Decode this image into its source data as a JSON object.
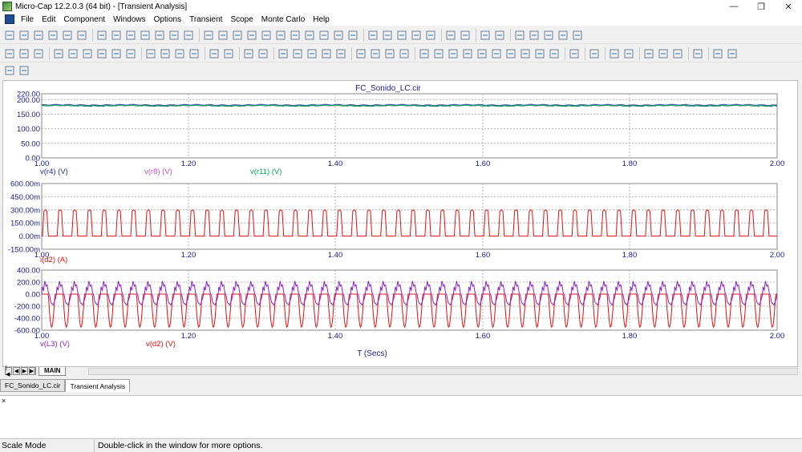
{
  "window": {
    "title": "Micro-Cap 12.2.0.3 (64 bit) - [Transient Analysis]",
    "minimize": "—",
    "restore": "❐",
    "close": "✕"
  },
  "menu": [
    "File",
    "Edit",
    "Component",
    "Windows",
    "Options",
    "Transient",
    "Scope",
    "Monte Carlo",
    "Help"
  ],
  "mdi": {
    "minimize": "—",
    "restore": "❐",
    "close": "✕"
  },
  "toolbar1_icons": [
    "new-icon",
    "open-icon",
    "save-icon",
    "save-all-icon",
    "print-preview-icon",
    "print-icon",
    "sep",
    "undo-icon",
    "redo-icon",
    "cut-icon",
    "copy-icon",
    "paste-icon",
    "delete-icon",
    "select-all-icon",
    "sep",
    "ground-icon",
    "sine-source-icon",
    "capacitor-icon",
    "inductor-icon",
    "diode-icon",
    "transistor-icon",
    "mosfet-icon",
    "opamp-icon",
    "resistor-icon",
    "battery-icon",
    "node-icon",
    "sep",
    "window-icon",
    "window-2-icon",
    "window-3-icon",
    "window-4-icon",
    "window-5-icon",
    "sep",
    "page-icon",
    "calculator-icon",
    "sep",
    "component-icon",
    "list-icon",
    "sep",
    "analysis-icon",
    "options-icon",
    "tools-icon",
    "plot-icon",
    "graph-icon"
  ],
  "toolbar2_icons": [
    "select-arrow-icon",
    "pan-icon",
    "help-icon",
    "sep",
    "zoom-box-icon",
    "scale-icon",
    "data-points-icon",
    "token-icon",
    "formula-icon",
    "text-icon",
    "sep",
    "properties-icon",
    "run-icon",
    "stop-icon",
    "pause-icon",
    "sep",
    "tool-1-icon",
    "tool-2-icon",
    "sep",
    "frame-icon",
    "grid-icon",
    "sep",
    "page-a-icon",
    "page-b-icon",
    "page-c-icon",
    "page-d-icon",
    "page-e-icon",
    "sep",
    "zoom-in-icon",
    "zoom-out-icon",
    "zoom-fit-icon",
    "cursor-icon",
    "sep",
    "peak-icon",
    "valley-icon",
    "high-icon",
    "low-icon",
    "inflection-icon",
    "global-high-icon",
    "global-low-icon",
    "top-icon",
    "bottom-icon",
    "slope-icon",
    "sep",
    "color-icon",
    "sep",
    "table-icon",
    "sep",
    "save-wave-icon",
    "load-wave-icon",
    "sep",
    "magnify-in-icon",
    "magnify-out-icon",
    "restore-view-icon",
    "sep",
    "tile-icon",
    "sep",
    "font-icon",
    "color-a-icon"
  ],
  "toolbar3_icons": [
    "step-icon",
    "tile-2-icon"
  ],
  "tabs": {
    "sheet_nav": [
      "|◀",
      "◀",
      "▶",
      "▶|"
    ],
    "sheet": "MAIN",
    "doc_tabs": [
      "FC_Sonido_LC.cir",
      "Transient Analysis"
    ]
  },
  "output": {
    "close_glyph": "×"
  },
  "status": {
    "mode": "Scale Mode",
    "message": "Double-click in the window for more options."
  },
  "colors": {
    "navy": "#1f2f8c",
    "steel": "#4a6fa8",
    "green": "#00a050",
    "red": "#e01010",
    "purple": "#8b1fc0",
    "magenta": "#c050c0",
    "axis_text": "#1a1a8a",
    "grid": "#a0a0a0"
  },
  "chart_data": [
    {
      "type": "line",
      "title": "FC_Sonido_LC.cir",
      "xlim": [
        1.0,
        2.0
      ],
      "x_ticks": [
        "1.00",
        "1.20",
        "1.40",
        "1.60",
        "1.80",
        "2.00"
      ],
      "ylim": [
        0,
        220
      ],
      "y_ticks": [
        "220.00",
        "200.00",
        "150.00",
        "100.00",
        "50.00",
        "0.00"
      ],
      "y_tick_values": [
        220,
        200,
        150,
        100,
        50,
        0
      ],
      "legend": [
        "v(r4) (V)",
        "v(r8) (V)",
        "v(r11) (V)"
      ],
      "series": [
        {
          "name": "v(r4) (V)",
          "approx": "~180 V DC with small ripple",
          "level": 180,
          "ripple": 3
        },
        {
          "name": "v(r8) (V)",
          "approx": "~182 V",
          "level": 182,
          "ripple": 2
        },
        {
          "name": "v(r11) (V)",
          "approx": "~179 V",
          "level": 179,
          "ripple": 2
        }
      ]
    },
    {
      "type": "line",
      "xlim": [
        1.0,
        2.0
      ],
      "x_ticks": [
        "1.00",
        "1.20",
        "1.40",
        "1.60",
        "1.80",
        "2.00"
      ],
      "ylim": [
        -150,
        600
      ],
      "y_ticks": [
        "600.00m",
        "450.00m",
        "300.00m",
        "150.00m",
        "0.00m",
        "-150.00m"
      ],
      "y_tick_values": [
        600,
        450,
        300,
        150,
        0,
        -150
      ],
      "legend": [
        "i(d2) (A)"
      ],
      "series": [
        {
          "name": "i(d2) (A)",
          "approx": "periodic current pulses ~0 to ~300 mA, ~50 pulses over 1 s",
          "peak": 300,
          "base": 0,
          "pulses": 50
        }
      ]
    },
    {
      "type": "line",
      "xlim": [
        1.0,
        2.0
      ],
      "x_ticks": [
        "1.00",
        "1.20",
        "1.40",
        "1.60",
        "1.80",
        "2.00"
      ],
      "xlabel": "T (Secs)",
      "ylim": [
        -600,
        400
      ],
      "y_ticks": [
        "400.00",
        "200.00",
        "0.00",
        "-200.00",
        "-400.00",
        "-600.00"
      ],
      "y_tick_values": [
        400,
        200,
        0,
        -200,
        -400,
        -600
      ],
      "legend": [
        "v(L3) (V)",
        "v(d2) (V)"
      ],
      "series": [
        {
          "name": "v(L3) (V)",
          "approx": "oscillating ~±250 V with ringing",
          "amplitude": 250,
          "cycles": 50
        },
        {
          "name": "v(d2) (V)",
          "approx": "~0 V with negative pulses to ~-550 V",
          "low": -550,
          "cycles": 50
        }
      ]
    }
  ]
}
